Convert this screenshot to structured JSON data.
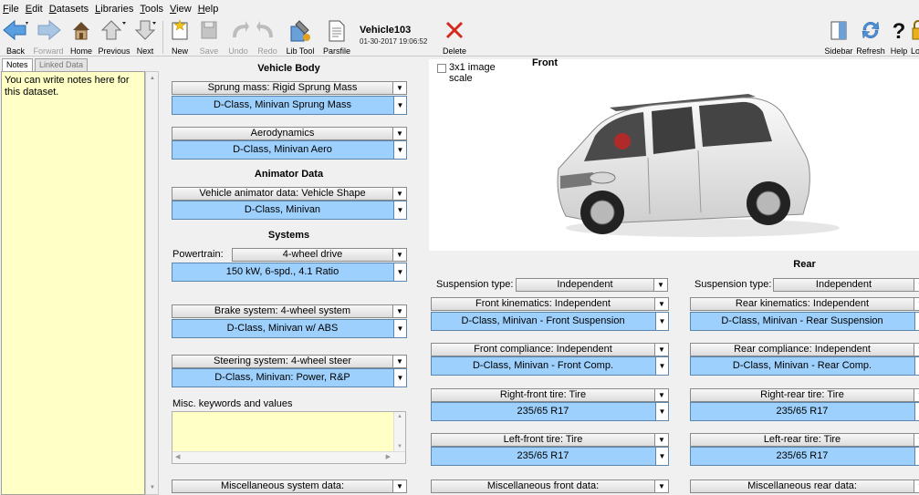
{
  "menu": [
    "File",
    "Edit",
    "Datasets",
    "Libraries",
    "Tools",
    "View",
    "Help"
  ],
  "toolbar": {
    "back": "Back",
    "forward": "Forward",
    "home": "Home",
    "previous": "Previous",
    "next": "Next",
    "new": "New",
    "save": "Save",
    "undo": "Undo",
    "redo": "Redo",
    "lib_tool": "Lib Tool",
    "parsfile": "Parsfile",
    "delete": "Delete",
    "sidebar": "Sidebar",
    "refresh": "Refresh",
    "help": "Help",
    "lock": "Lo"
  },
  "dataset": {
    "name": "Vehicle103",
    "date": "01-30-2017 19:06:52"
  },
  "left_panel": {
    "tabs": [
      "Notes",
      "Linked Data"
    ],
    "notes_text": "You can write notes here for this dataset."
  },
  "image_panel": {
    "checkbox_label_1": "3x1 image",
    "checkbox_label_2": "scale"
  },
  "vehicle_body": {
    "heading": "Vehicle Body",
    "sprung_link": "Sprung mass: Rigid Sprung Mass",
    "sprung_ds": "D-Class, Minivan Sprung Mass",
    "aero_link": "Aerodynamics",
    "aero_ds": "D-Class, Minivan Aero"
  },
  "animator": {
    "heading": "Animator Data",
    "link": "Vehicle animator data: Vehicle Shape",
    "ds": "D-Class, Minivan"
  },
  "systems": {
    "heading": "Systems",
    "powertrain_label": "Powertrain:",
    "powertrain_value": "4-wheel drive",
    "powertrain_ds": "150 kW, 6-spd., 4.1 Ratio",
    "brake_link": "Brake system: 4-wheel system",
    "brake_ds": "D-Class, Minivan w/ ABS",
    "steer_link": "Steering system: 4-wheel steer",
    "steer_ds": "D-Class, Minivan: Power, R&P",
    "misc_label": "Misc. keywords and values",
    "misc_link": "Miscellaneous system data:"
  },
  "front": {
    "heading": "Front",
    "susp_label": "Suspension type:",
    "susp_value": "Independent",
    "kin_link": "Front kinematics: Independent",
    "kin_ds": "D-Class, Minivan - Front Suspension",
    "comp_link": "Front compliance: Independent",
    "comp_ds": "D-Class, Minivan - Front Comp.",
    "rt_link": "Right-front tire: Tire",
    "rt_ds": "235/65 R17",
    "lt_link": "Left-front tire: Tire",
    "lt_ds": "235/65 R17",
    "misc_link": "Miscellaneous front data:"
  },
  "rear": {
    "heading": "Rear",
    "susp_label": "Suspension type:",
    "susp_value": "Independent",
    "kin_link": "Rear kinematics: Independent",
    "kin_ds": "D-Class, Minivan - Rear Suspension",
    "comp_link": "Rear compliance: Independent",
    "comp_ds": "D-Class, Minivan - Rear Comp.",
    "rt_link": "Right-rear tire: Tire",
    "rt_ds": "235/65 R17",
    "lt_link": "Left-rear tire: Tire",
    "lt_ds": "235/65 R17",
    "misc_link": "Miscellaneous rear data:"
  },
  "colors": {
    "dataset_blue": "#9dd0fc",
    "notes_yellow": "#ffffc6",
    "delete_red": "#d42a1e"
  }
}
